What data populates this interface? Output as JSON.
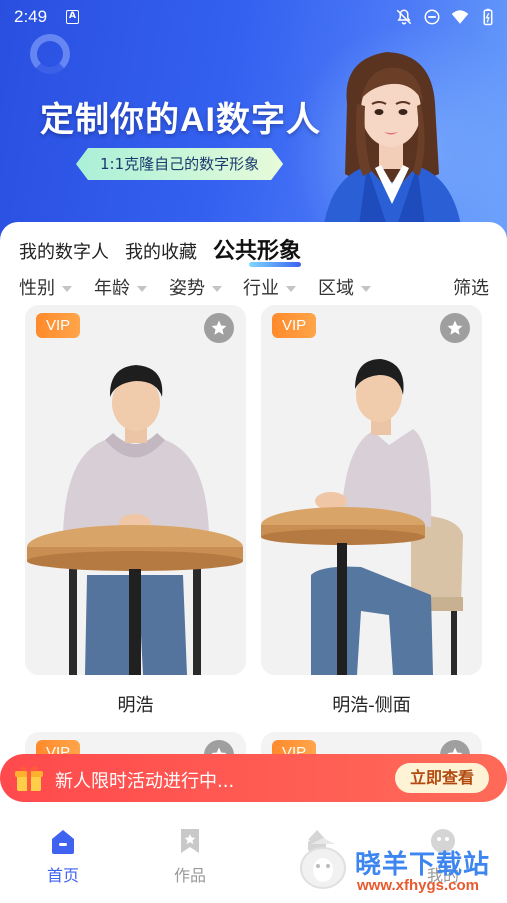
{
  "status_bar": {
    "time": "2:49",
    "left_badge": "A",
    "icons": [
      "notifications-off-icon",
      "do-not-disturb-icon",
      "wifi-icon",
      "battery-icon"
    ]
  },
  "banner": {
    "title": "定制你的AI数字人",
    "subtitle": "1:1克隆自己的数字形象"
  },
  "tabs": [
    {
      "label": "我的数字人",
      "active": false
    },
    {
      "label": "我的收藏",
      "active": false
    },
    {
      "label": "公共形象",
      "active": true
    }
  ],
  "filters": {
    "items": [
      "性别",
      "年龄",
      "姿势",
      "行业",
      "区域"
    ],
    "right_label": "筛选"
  },
  "cards": [
    {
      "badge": "VIP",
      "name": "明浩"
    },
    {
      "badge": "VIP",
      "name": "明浩-侧面"
    },
    {
      "badge": "VIP",
      "name": ""
    },
    {
      "badge": "VIP",
      "name": ""
    }
  ],
  "promo": {
    "text": "新人限时活动进行中...",
    "button": "立即查看"
  },
  "bottom_nav": [
    {
      "label": "首页",
      "icon": "home-icon",
      "active": true
    },
    {
      "label": "作品",
      "icon": "bookmark-icon",
      "active": false
    },
    {
      "label": "",
      "icon": "create-icon",
      "active": false
    },
    {
      "label": "我的",
      "icon": "profile-icon",
      "active": false
    }
  ],
  "watermark": {
    "title": "晓羊下载站",
    "url": "www.xfhygs.com"
  },
  "colors": {
    "brand_blue": "#3461f0",
    "vip_orange": "#ff8a2b",
    "promo_red": "#ff4a4d",
    "nav_active": "#3f63f0"
  }
}
